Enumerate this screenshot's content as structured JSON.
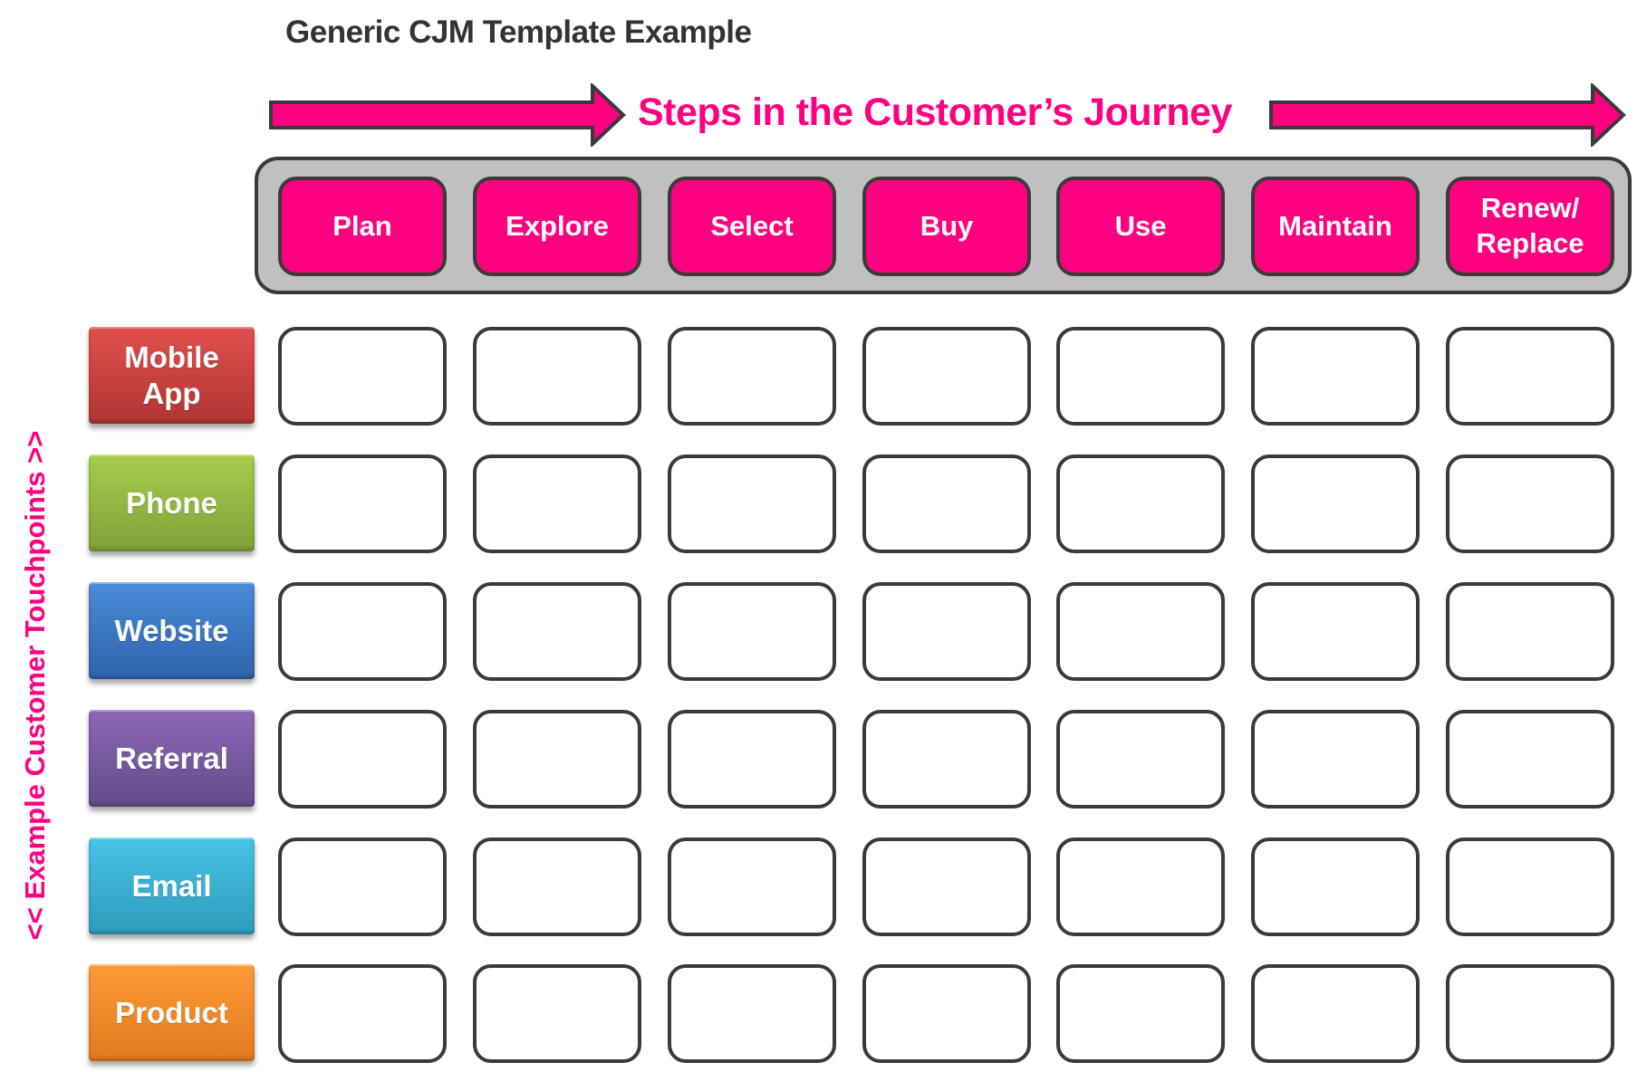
{
  "title": "Generic CJM Template Example",
  "journey_label": "Steps in the Customer’s Journey",
  "touchpoints_axis_label": "<< Example Customer Touchpoints >>",
  "colors": {
    "accent": "#FF0080",
    "container_fill": "#C0C0C0",
    "outline": "#3A3A3A",
    "title_text": "#333333"
  },
  "steps": [
    {
      "label": "Plan"
    },
    {
      "label": "Explore"
    },
    {
      "label": "Select"
    },
    {
      "label": "Buy"
    },
    {
      "label": "Use"
    },
    {
      "label": "Maintain"
    },
    {
      "label": "Renew/\nReplace"
    }
  ],
  "touchpoints": [
    {
      "label": "Mobile\nApp",
      "color_top": "#E0504D",
      "color_bottom": "#B03532"
    },
    {
      "label": "Phone",
      "color_top": "#A6CE4C",
      "color_bottom": "#7FA03A"
    },
    {
      "label": "Website",
      "color_top": "#4A8BDA",
      "color_bottom": "#2E64AA"
    },
    {
      "label": "Referral",
      "color_top": "#8C68B4",
      "color_bottom": "#634C8C"
    },
    {
      "label": "Email",
      "color_top": "#46C4E6",
      "color_bottom": "#2E9CBC"
    },
    {
      "label": "Product",
      "color_top": "#FD9B36",
      "color_bottom": "#E07A1E"
    }
  ],
  "grid_cells": [
    [
      "",
      "",
      "",
      "",
      "",
      "",
      ""
    ],
    [
      "",
      "",
      "",
      "",
      "",
      "",
      ""
    ],
    [
      "",
      "",
      "",
      "",
      "",
      "",
      ""
    ],
    [
      "",
      "",
      "",
      "",
      "",
      "",
      ""
    ],
    [
      "",
      "",
      "",
      "",
      "",
      "",
      ""
    ],
    [
      "",
      "",
      "",
      "",
      "",
      "",
      ""
    ]
  ]
}
